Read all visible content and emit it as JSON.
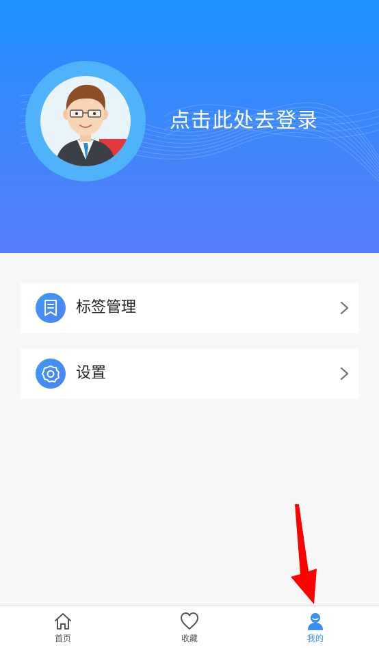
{
  "header": {
    "login_text": "点击此处去登录"
  },
  "menu": [
    {
      "label": "标签管理",
      "icon": "bookmark-list-icon"
    },
    {
      "label": "设置",
      "icon": "gear-icon"
    }
  ],
  "tabbar": {
    "tabs": [
      {
        "label": "首页",
        "icon": "home-icon",
        "active": false
      },
      {
        "label": "收藏",
        "icon": "heart-icon",
        "active": false
      },
      {
        "label": "我的",
        "icon": "user-icon",
        "active": true
      }
    ]
  },
  "colors": {
    "header_top": "#1e90ff",
    "header_bottom": "#587dfb",
    "accent": "#3a8ef2",
    "annotation_arrow": "#ff0000"
  }
}
